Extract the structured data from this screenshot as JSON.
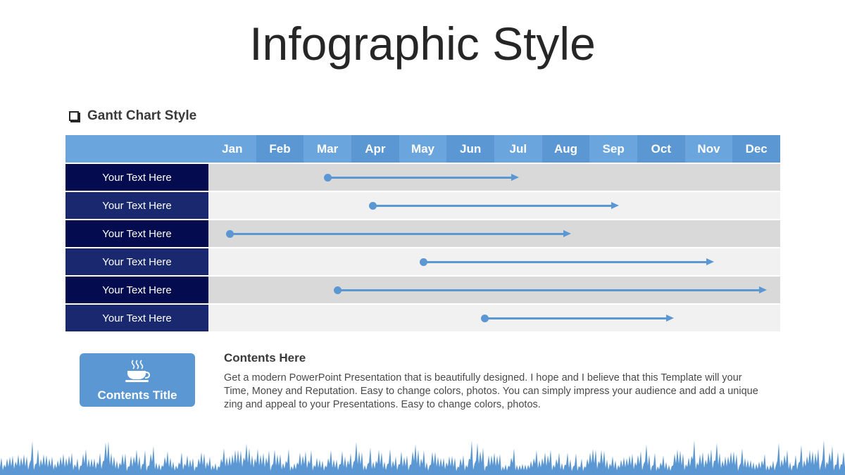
{
  "title": "Infographic Style",
  "section": {
    "heading": "Gantt Chart Style",
    "icon": "checkbox-icon"
  },
  "gantt": {
    "months": [
      "Jan",
      "Feb",
      "Mar",
      "Apr",
      "May",
      "Jun",
      "Jul",
      "Aug",
      "Sep",
      "Oct",
      "Nov",
      "Dec"
    ],
    "rows": [
      {
        "label": "Your Text Here",
        "start": 2.5,
        "end": 6.5
      },
      {
        "label": "Your Text Here",
        "start": 3.45,
        "end": 8.6
      },
      {
        "label": "Your Text Here",
        "start": 0.45,
        "end": 7.6
      },
      {
        "label": "Your Text Here",
        "start": 4.5,
        "end": 10.6
      },
      {
        "label": "Your Text Here",
        "start": 2.7,
        "end": 11.7
      },
      {
        "label": "Your Text Here",
        "start": 5.8,
        "end": 9.75
      }
    ],
    "colors": {
      "header": "#6aa6dd",
      "header_alt": "#5b97d3",
      "label_dark": "#040b4e",
      "label_light": "#1a2870",
      "track_dark": "#d9d9d9",
      "track_light": "#f1f1f1",
      "bar": "#5b97d3"
    }
  },
  "card": {
    "title": "Contents Title",
    "icon": "coffee-cup-icon"
  },
  "content": {
    "heading": "Contents Here",
    "body": "Get a modern PowerPoint  Presentation that is beautifully designed. I hope and I believe that this Template will your Time, Money and Reputation. Easy to change colors, photos. You can simply impress your audience and add a unique zing and appeal to your Presentations. Easy to change colors, photos."
  }
}
